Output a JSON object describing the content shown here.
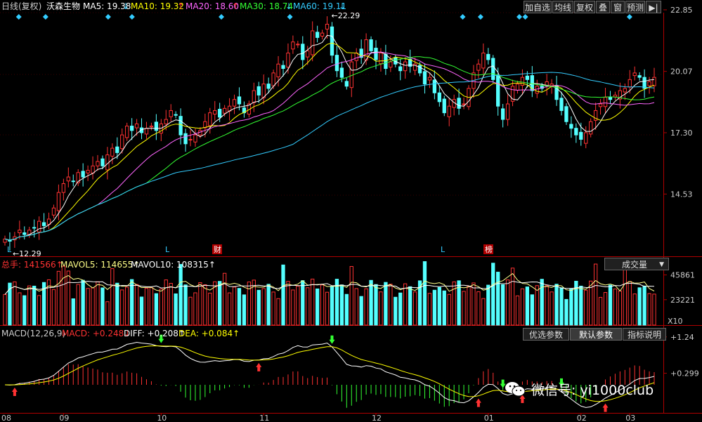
{
  "header": {
    "prefix": "日线(复权)",
    "stock_name": "沃森生物",
    "ma": [
      {
        "label": "MA5: 19.38",
        "arrow": "↓",
        "color": "#ffffff"
      },
      {
        "label": "MA10: 19.32",
        "arrow": "↑",
        "color": "#ffff00"
      },
      {
        "label": "MA20: 18.60",
        "arrow": "↑",
        "color": "#ff66ff"
      },
      {
        "label": "MA30: 18.74",
        "arrow": "↓",
        "color": "#33ff33"
      },
      {
        "label": "MA60: 19.11",
        "arrow": "↓",
        "color": "#33ccff"
      }
    ]
  },
  "toolbar": {
    "buttons": [
      "加自选",
      "均线",
      "复权",
      "叠",
      "窗",
      "预测"
    ],
    "nav_icon": "▶|"
  },
  "volume_header": {
    "total": "总手: 141566↑",
    "mavol5": "MAVOL5: 114655↑",
    "mavol10": "MAVOL10: 108315↑",
    "dropdown": "成交量"
  },
  "macd_header": {
    "name": "MACD(12,26,9)",
    "macd": "MACD: +0.248↓",
    "diff": "DIFF: +0.208↑",
    "dea": "DEA: +0.084↑",
    "tabs": [
      "优选参数",
      "默认参数",
      "指标说明"
    ],
    "selected_tab": "默认参数"
  },
  "watermark": {
    "text": "微信号: yi1000club",
    "icon": "wechat-icon"
  },
  "colors": {
    "up": "#ff3232",
    "down": "#54ffff",
    "ma5": "#ffffff",
    "ma10": "#ffff00",
    "ma20": "#ff66ff",
    "ma30": "#33ff33",
    "ma60": "#33ccff",
    "axis": "#b00000"
  },
  "chart_data": [
    {
      "type": "candlestick",
      "panel": "price",
      "y_ticks": [
        22.85,
        20.07,
        17.3,
        14.53
      ],
      "ylim": [
        11.75,
        22.85
      ],
      "x_tick_labels": [
        "08",
        "09",
        "10",
        "11",
        "12",
        "01",
        "02",
        "03"
      ],
      "annotations": [
        {
          "text": "22.29",
          "kind": "high"
        },
        {
          "text": "12.29",
          "kind": "low"
        }
      ],
      "event_markers": [
        "L",
        "L",
        "财",
        "L",
        "榜"
      ],
      "closes": [
        12.5,
        12.4,
        12.6,
        12.9,
        12.7,
        12.9,
        13.0,
        13.3,
        13.1,
        13.4,
        13.9,
        14.6,
        15.0,
        15.3,
        15.1,
        15.5,
        15.3,
        15.6,
        15.8,
        16.0,
        15.8,
        16.3,
        16.6,
        16.4,
        17.2,
        17.6,
        17.4,
        17.7,
        17.3,
        17.5,
        17.6,
        17.4,
        17.7,
        17.9,
        18.3,
        18.1,
        17.2,
        16.8,
        17.0,
        17.2,
        17.4,
        17.8,
        18.2,
        18.3,
        18.0,
        18.4,
        18.5,
        18.8,
        18.6,
        18.2,
        18.6,
        19.2,
        19.0,
        19.5,
        19.3,
        20.0,
        20.4,
        20.2,
        20.9,
        21.4,
        21.3,
        20.6,
        21.0,
        21.9,
        21.6,
        21.8,
        22.2,
        20.8,
        20.1,
        19.8,
        19.4,
        20.5,
        20.9,
        20.7,
        21.5,
        21.0,
        20.6,
        20.9,
        20.2,
        20.5,
        20.4,
        20.1,
        20.5,
        20.3,
        20.4,
        20.0,
        19.5,
        19.8,
        19.1,
        18.7,
        18.2,
        18.5,
        18.8,
        18.4,
        18.6,
        19.3,
        20.0,
        20.4,
        20.9,
        20.6,
        19.7,
        18.5,
        17.9,
        18.6,
        19.4,
        19.5,
        19.8,
        19.7,
        19.2,
        19.4,
        19.3,
        19.6,
        19.5,
        18.8,
        18.3,
        17.8,
        17.5,
        17.2,
        17.0,
        17.3,
        17.8,
        18.3,
        18.6,
        18.9,
        18.8,
        19.0,
        19.2,
        19.3,
        19.7,
        20.0,
        19.8,
        19.3,
        19.6,
        19.8
      ],
      "volume_ticks": [
        45861,
        23221
      ],
      "volume_unit": "X10",
      "macd_ticks": [
        "+1.24",
        "+0.299"
      ]
    }
  ]
}
